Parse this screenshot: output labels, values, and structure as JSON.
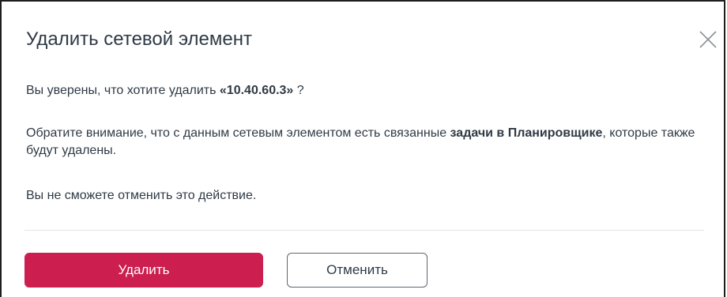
{
  "dialog": {
    "title": "Удалить сетевой элемент",
    "close_icon": "close-icon",
    "confirm": {
      "prefix": "Вы уверены, что хотите удалить ",
      "target": "«10.40.60.3»",
      "suffix": " ?"
    },
    "notice": {
      "prefix": "Обратите внимание, что с данным сетевым элементом есть связанные ",
      "bold": "задачи в Планировщике",
      "suffix": ", которые также будут удалены."
    },
    "warning": "Вы не сможете отменить это действие.",
    "buttons": {
      "delete_label": "Удалить",
      "cancel_label": "Отменить"
    }
  },
  "colors": {
    "delete_button": "#cc1f4f",
    "text": "#2f3a45",
    "divider": "#e3e6ea"
  }
}
